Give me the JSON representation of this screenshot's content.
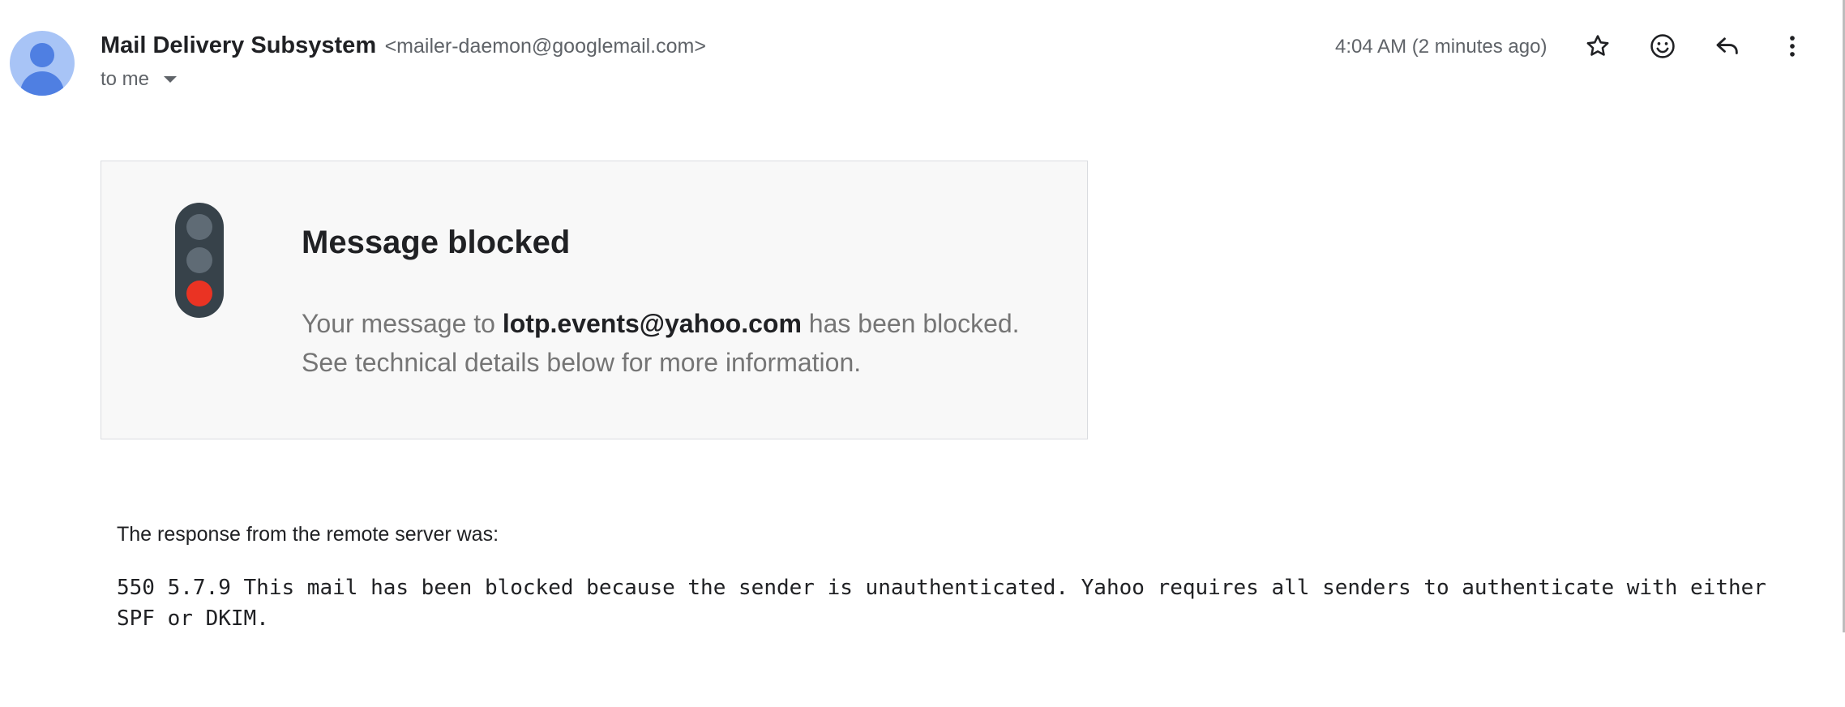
{
  "header": {
    "sender_name": "Mail Delivery Subsystem",
    "sender_email": "<mailer-daemon@googlemail.com>",
    "recipient": "to me",
    "timestamp": "4:04 AM (2 minutes ago)",
    "icons": [
      "star-icon",
      "emoji-icon",
      "reply-icon",
      "more-vert-icon"
    ]
  },
  "card": {
    "title": "Message blocked",
    "text_before": "Your message to ",
    "recipient_address": "lotp.events@yahoo.com",
    "text_after": " has been blocked.",
    "text_line2": "See technical details below for more information.",
    "light_colors": {
      "off": "#5f6b75",
      "on": "#ea3323",
      "housing": "#37424a"
    }
  },
  "response": {
    "label": "The response from the remote server was:",
    "code": "550 5.7.9 This mail has been blocked because the sender is unauthenticated. Yahoo requires all senders to authenticate with either SPF or DKIM."
  }
}
